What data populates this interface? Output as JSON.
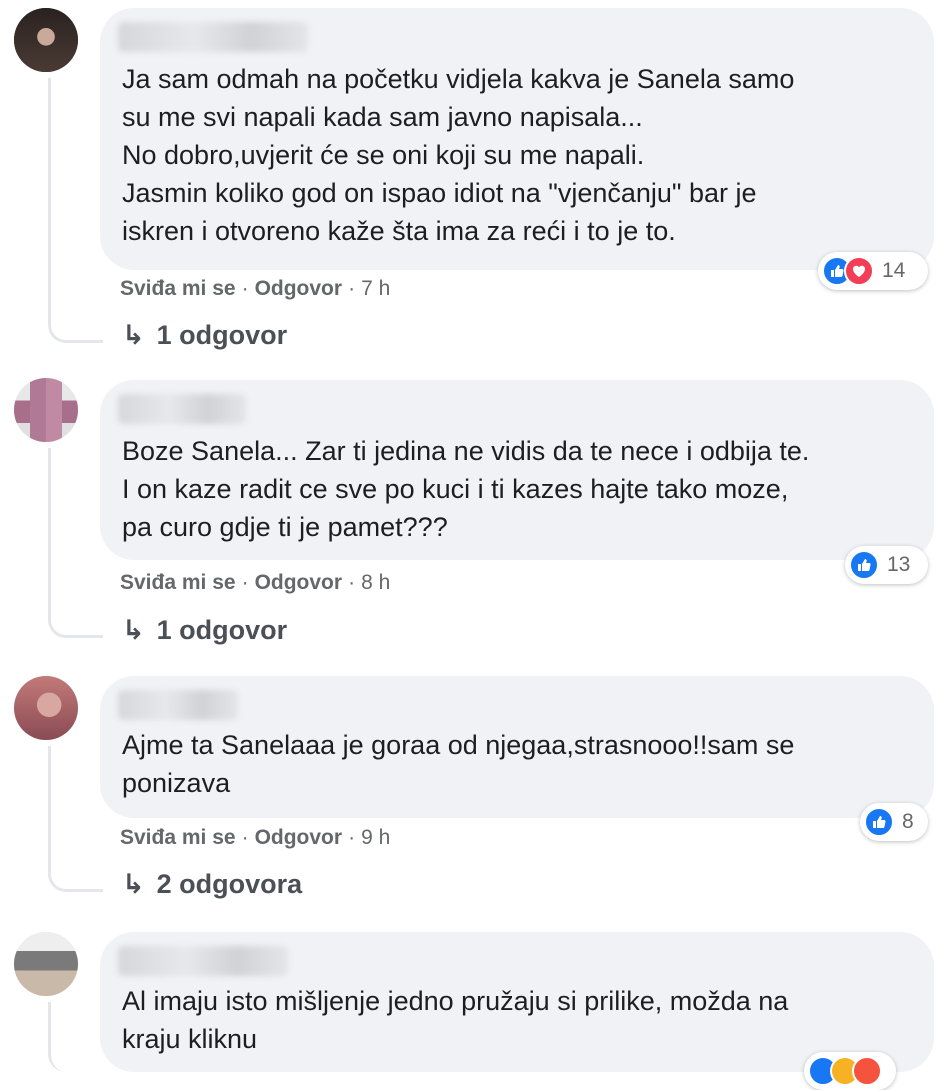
{
  "comments": [
    {
      "text": "Ja sam odmah na početku vidjela kakva je Sanela samo\nsu me svi napali kada sam javno napisala...\nNo dobro,uvjerit će se oni koji su me napali.\nJasmin koliko god on ispao idiot na \"vjenčanju\" bar je\niskren i otvoreno kaže šta ima za reći i to je to.",
      "like_label": "Sviđa mi se",
      "reply_label": "Odgovor",
      "time": "7 h",
      "reaction_count": "14",
      "replies": "1 odgovor"
    },
    {
      "text": "Boze Sanela... Zar ti jedina ne vidis da te nece i odbija te.\nI on kaze radit ce sve po kuci i ti kazes hajte tako moze,\npa curo gdje ti je pamet???",
      "like_label": "Sviđa mi se",
      "reply_label": "Odgovor",
      "time": "8 h",
      "reaction_count": "13",
      "replies": "1 odgovor"
    },
    {
      "text": "Ajme ta Sanelaaa je goraa od njegaa,strasnooo!!sam se\nponizava",
      "like_label": "Sviđa mi se",
      "reply_label": "Odgovor",
      "time": "9 h",
      "reaction_count": "8",
      "replies": "2 odgovora"
    },
    {
      "text": "Al imaju isto mišljenje jedno pružaju si prilike, možda na\nkraju kliknu"
    }
  ],
  "separator": "·",
  "reply_arrow": "↳",
  "colors": {
    "bubble": "#f0f2f5",
    "like": "#1877f2",
    "love": "#f33e58",
    "haha": "#f7b125",
    "meta": "#65676b"
  },
  "icons": [
    "like-reaction-icon",
    "love-reaction-icon",
    "haha-reaction-icon",
    "reply-arrow-icon"
  ]
}
